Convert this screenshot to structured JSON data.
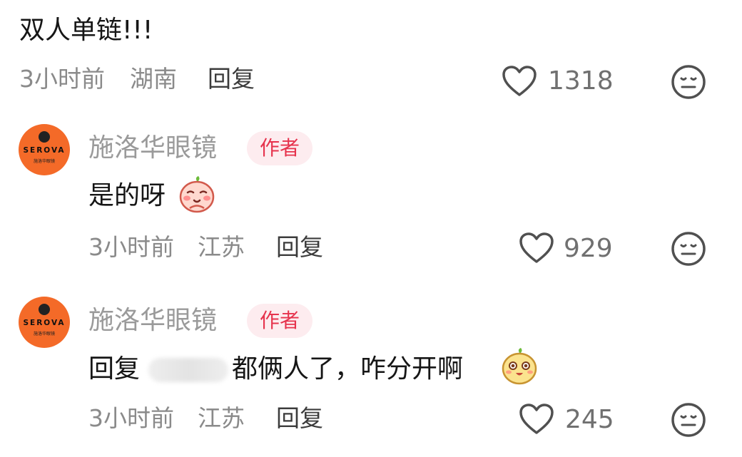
{
  "top_comment": {
    "text": "双人单链!!!",
    "time": "3小时前",
    "location": "湖南",
    "reply_label": "回复",
    "likes": "1318"
  },
  "replies": [
    {
      "author": "施洛华眼镜",
      "badge": "作者",
      "avatar_brand": "SEROVA",
      "avatar_subtext": "施洛华眼镜",
      "text": "是的呀",
      "emoji": "happy-bean-emoji",
      "time": "3小时前",
      "location": "江苏",
      "reply_label": "回复",
      "likes": "929"
    },
    {
      "author": "施洛华眼镜",
      "badge": "作者",
      "avatar_brand": "SEROVA",
      "avatar_subtext": "施洛华眼镜",
      "text_prefix": "回复",
      "text": "都俩人了，咋分开啊",
      "emoji": "surprised-bean-emoji",
      "time": "3小时前",
      "location": "江苏",
      "reply_label": "回复",
      "likes": "245"
    }
  ],
  "colors": {
    "avatar": "#f46a28",
    "badge_bg": "#fdecef",
    "badge_text": "#e6334d",
    "meta": "#8a8a8a"
  },
  "icons": [
    "heart-outline-icon",
    "meh-face-icon"
  ]
}
